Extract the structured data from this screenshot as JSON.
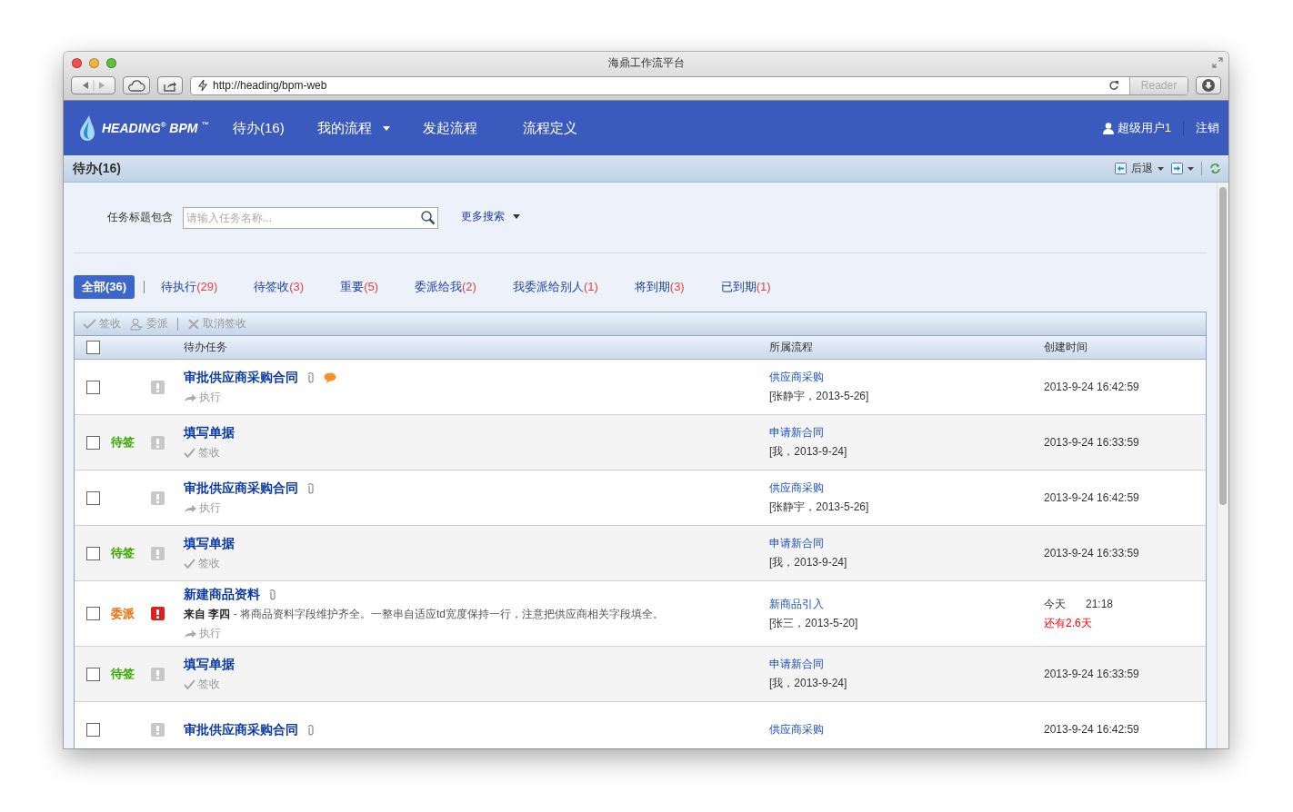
{
  "window": {
    "title": "海鼎工作流平台",
    "url": "http://heading/bpm-web",
    "reader": "Reader"
  },
  "nav": {
    "logo": "HEADING",
    "logo_reg": "®",
    "logo_product": "BPM",
    "logo_tm": "™",
    "items": [
      {
        "label": "待办(16)",
        "dropdown": false
      },
      {
        "label": "我的流程",
        "dropdown": true
      },
      {
        "label": "发起流程",
        "dropdown": false
      },
      {
        "label": "流程定义",
        "dropdown": false
      }
    ],
    "user": "超级用户1",
    "logout": "注销"
  },
  "page_header": {
    "title": "待办(16)",
    "back": "后退"
  },
  "search": {
    "label": "任务标题包含",
    "placeholder": "请输入任务名称...",
    "more": "更多搜索"
  },
  "filter_tabs": [
    {
      "label": "全部",
      "count": "(36)",
      "selected": true
    },
    {
      "label": "待执行",
      "count": "(29)",
      "selected": false
    },
    {
      "label": "待签收",
      "count": "(3)",
      "selected": false
    },
    {
      "label": "重要",
      "count": "(5)",
      "selected": false
    },
    {
      "label": "委派给我",
      "count": "(2)",
      "selected": false
    },
    {
      "label": "我委派给别人",
      "count": "(1)",
      "selected": false
    },
    {
      "label": "将到期",
      "count": "(3)",
      "selected": false
    },
    {
      "label": "已到期",
      "count": "(1)",
      "selected": false
    }
  ],
  "actions": [
    {
      "label": "签收",
      "kind": "sign"
    },
    {
      "label": "委派",
      "kind": "delegate"
    },
    {
      "label": "取消签收",
      "kind": "cancel"
    }
  ],
  "table": {
    "select_all_checked": false,
    "columns": [
      "待办任务",
      "所属流程",
      "创建时间"
    ],
    "rows": [
      {
        "checked": false,
        "important": false,
        "title": "审批供应商采购合同",
        "icons": [
          {
            "kind": "attachment"
          },
          {
            "kind": "comment"
          }
        ],
        "action": {
          "kind": "execute",
          "label": "执行"
        },
        "process": "供应商采购",
        "meta": "[张静宇，2013-5-26]",
        "time": "2013-9-24 16:42:59"
      },
      {
        "checked": false,
        "status": {
          "kind": "sign",
          "label": "待签"
        },
        "important": false,
        "title": "填写单据",
        "action": {
          "kind": "sign",
          "label": "签收"
        },
        "process": "申请新合同",
        "meta": "[我，2013-9-24]",
        "time": "2013-9-24 16:33:59"
      },
      {
        "checked": false,
        "important": false,
        "title": "审批供应商采购合同",
        "icons": [
          {
            "kind": "attachment"
          }
        ],
        "action": {
          "kind": "execute",
          "label": "执行"
        },
        "process": "供应商采购",
        "meta": "[张静宇，2013-5-26]",
        "time": "2013-9-24 16:42:59"
      },
      {
        "checked": false,
        "status": {
          "kind": "sign",
          "label": "待签"
        },
        "important": false,
        "title": "填写单据",
        "action": {
          "kind": "sign",
          "label": "签收"
        },
        "process": "申请新合同",
        "meta": "[我，2013-9-24]",
        "time": "2013-9-24 16:33:59"
      },
      {
        "checked": false,
        "status": {
          "kind": "delegate",
          "label": "委派"
        },
        "important": true,
        "title": "新建商品资料",
        "icons": [
          {
            "kind": "attachment"
          }
        ],
        "note": "**来自  李四** - 将商品资料字段维护齐全。一整串自适应td宽度保持一行，注意把供应商相关字段填全。",
        "action": {
          "kind": "execute",
          "label": "执行"
        },
        "process": "新商品引入",
        "meta": "[张三，2013-5-20]",
        "day": "今天",
        "time": "21:18",
        "remaining": "还有2.6天"
      },
      {
        "checked": false,
        "status": {
          "kind": "sign",
          "label": "待签"
        },
        "important": false,
        "title": "填写单据",
        "action": {
          "kind": "sign",
          "label": "签收"
        },
        "process": "申请新合同",
        "meta": "[我，2013-9-24]",
        "time": "2013-9-24 16:33:59"
      },
      {
        "checked": false,
        "important": false,
        "title": "审批供应商采购合同",
        "icons": [
          {
            "kind": "attachment"
          }
        ],
        "process": "供应商采购",
        "time": "2013-9-24 16:42:59"
      }
    ]
  }
}
